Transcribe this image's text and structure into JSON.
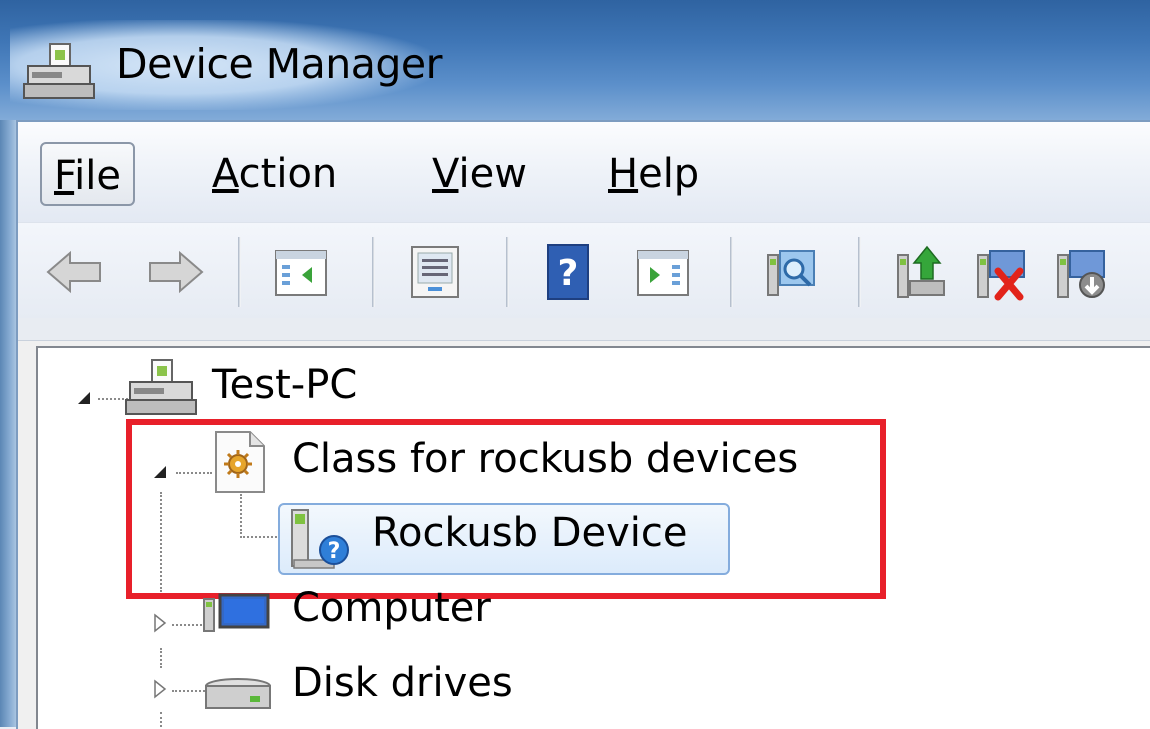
{
  "window": {
    "title": "Device Manager"
  },
  "menu": [
    {
      "id": "file",
      "accel": "F",
      "rest": "ile"
    },
    {
      "id": "action",
      "accel": "A",
      "rest": "ction"
    },
    {
      "id": "view",
      "accel": "V",
      "rest": "iew"
    },
    {
      "id": "help",
      "accel": "H",
      "rest": "elp"
    }
  ],
  "toolbar": {
    "buttons": [
      "back-icon",
      "forward-icon",
      "show-hide-console-tree-icon",
      "properties-icon",
      "help-icon",
      "show-hide-action-pane-icon",
      "scan-hardware-changes-icon",
      "update-driver-icon",
      "uninstall-device-icon",
      "disable-device-icon"
    ]
  },
  "tree": {
    "root": "Test-PC",
    "class_node": "Class for rockusb devices",
    "device": "Rockusb Device",
    "computer": "Computer",
    "disk": "Disk drives"
  },
  "colors": {
    "highlight": "#e8202a",
    "selection": "#dcebfb"
  }
}
